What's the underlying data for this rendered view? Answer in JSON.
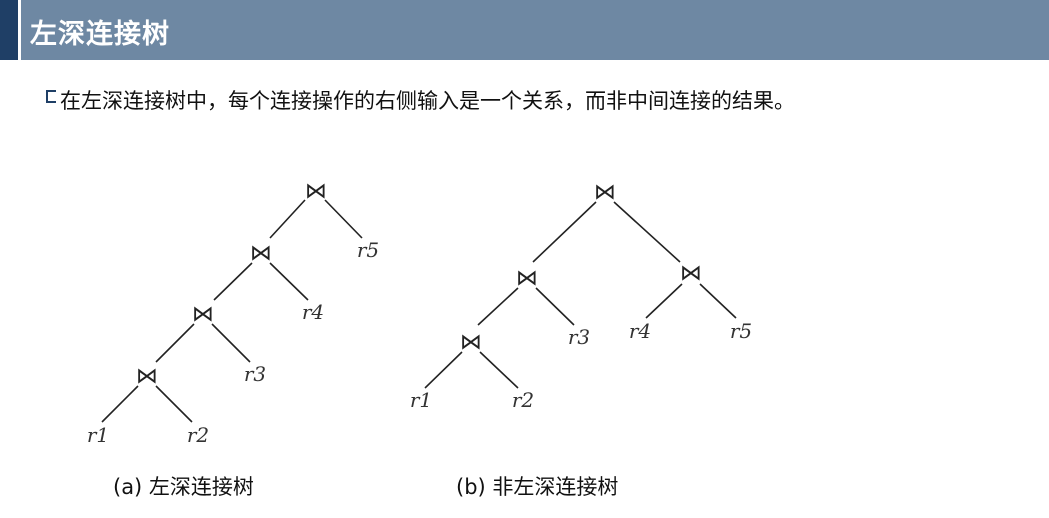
{
  "slide": {
    "title": "左深连接树",
    "bullet_icon": "square-bullet-icon",
    "description": "在左深连接树中，每个连接操作的右侧输入是一个关系，而非中间连接的结果。"
  },
  "diagrams": {
    "join_symbol": "⋈",
    "left_deep": {
      "caption": "(a) 左深连接树",
      "leaves": [
        "r1",
        "r2",
        "r3",
        "r4",
        "r5"
      ]
    },
    "non_left_deep": {
      "caption": "(b) 非左深连接树",
      "leaves": [
        "r1",
        "r2",
        "r3",
        "r4",
        "r5"
      ]
    }
  },
  "colors": {
    "header_bg": "#6e88a3",
    "header_accent": "#1f3f66",
    "line": "#222222"
  }
}
